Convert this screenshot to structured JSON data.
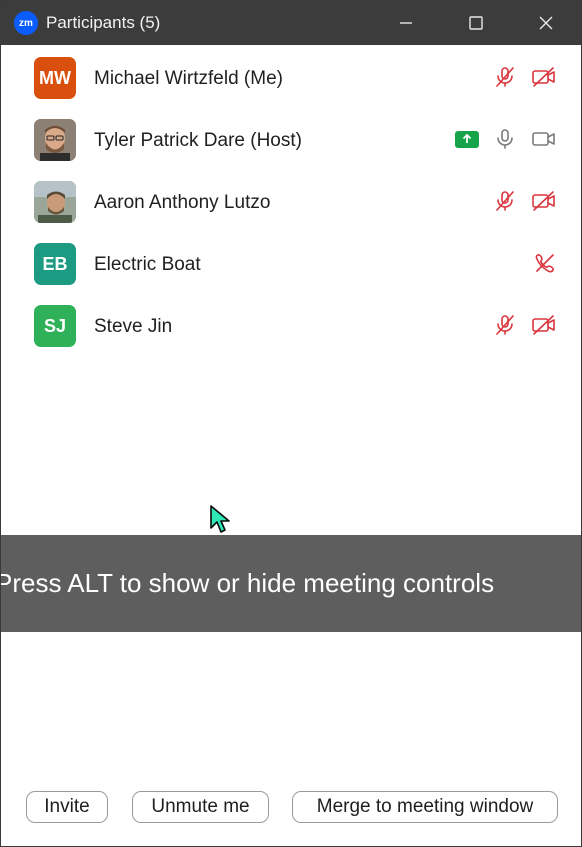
{
  "window": {
    "title": "Participants (5)",
    "logo_text": "zm"
  },
  "participants": [
    {
      "initials": "MW",
      "name": "Michael Wirtzfeld (Me)",
      "avatar_color": "#d94f0e",
      "status": "muted, video off"
    },
    {
      "initials": "",
      "name": "Tyler Patrick Dare (Host)",
      "avatar_color": "#6b5a4e",
      "status": "sharing, unmuted, video on"
    },
    {
      "initials": "",
      "name": "Aaron Anthony Lutzo",
      "avatar_color": "#7a8a7a",
      "status": "muted, video off"
    },
    {
      "initials": "EB",
      "name": "Electric Boat",
      "avatar_color": "#1d9b82",
      "status": "phone muted"
    },
    {
      "initials": "SJ",
      "name": "Steve Jin",
      "avatar_color": "#2fb15a",
      "status": "muted, video off"
    }
  ],
  "overlay": {
    "text": "Press ALT to show or hide meeting controls"
  },
  "footer": {
    "invite_label": "Invite",
    "unmute_label": "Unmute me",
    "merge_label": "Merge to meeting window"
  },
  "colors": {
    "muted_red": "#d9363e",
    "share_green": "#16a34a",
    "titlebar": "#3c3c3c"
  }
}
